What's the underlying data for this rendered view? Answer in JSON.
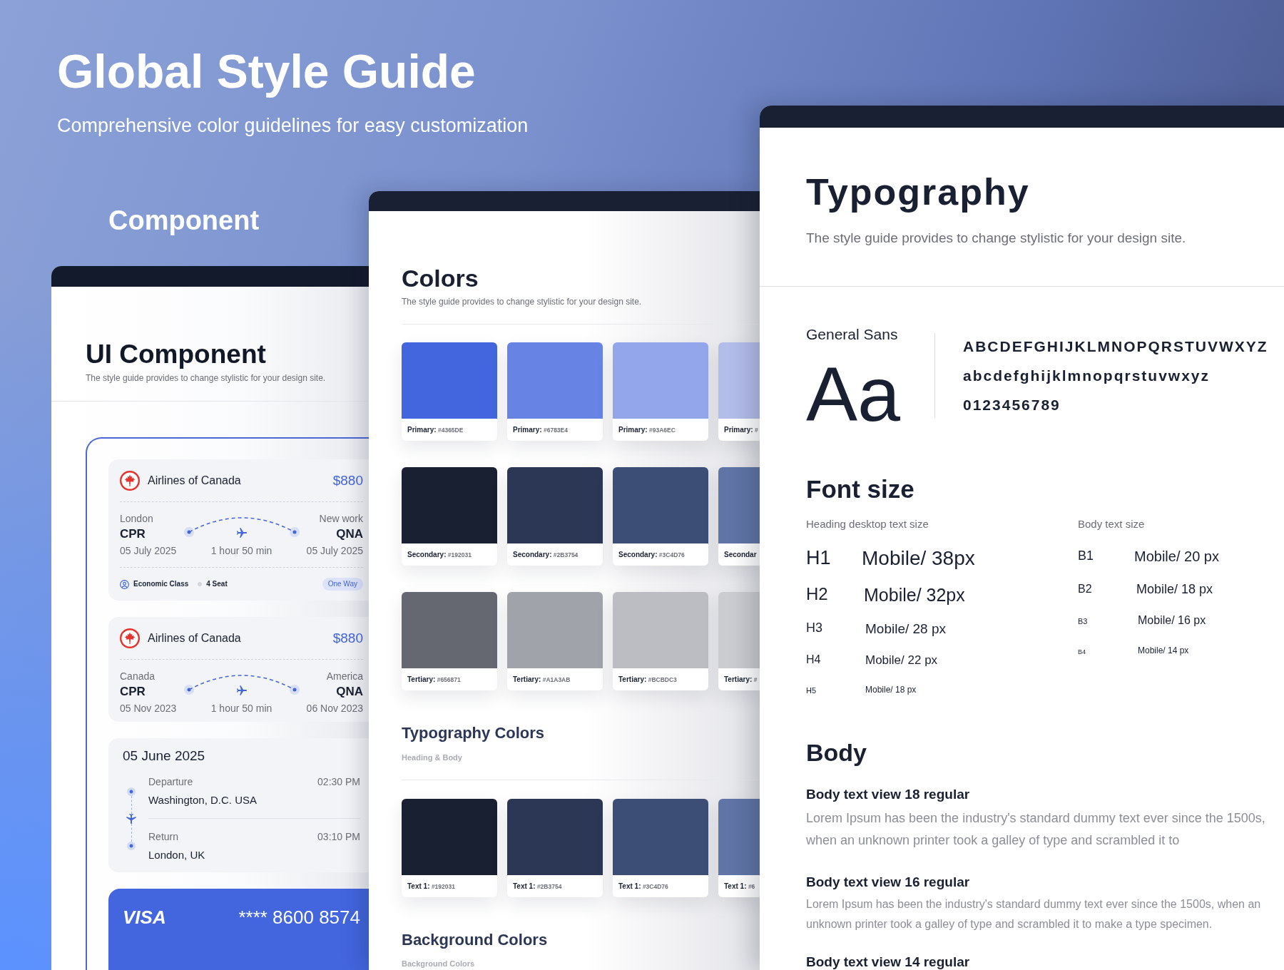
{
  "header": {
    "title": "Global Style Guide",
    "subtitle": "Comprehensive color guidelines for easy customization"
  },
  "component_section": {
    "label": "Component",
    "panel": {
      "title": "UI Component",
      "description": "The style guide provides to change stylistic for your design site.",
      "flights": [
        {
          "airline": "Airlines of Canada",
          "price": "$880",
          "origin": {
            "city": "London",
            "code": "CPR",
            "date": "05 July 2025"
          },
          "destination": {
            "city": "New work",
            "code": "QNA",
            "date": "05 July 2025"
          },
          "duration": "1 hour 50 min",
          "details": {
            "cabin": "Economic Class",
            "seats": "4 Seat",
            "trip_type": "One Way"
          }
        },
        {
          "airline": "Airlines of Canada",
          "price": "$880",
          "origin": {
            "city": "Canada",
            "code": "CPR",
            "date": "05 Nov 2023"
          },
          "destination": {
            "city": "America",
            "code": "QNA",
            "date": "06 Nov 2023"
          },
          "duration": "1 hour 50 min"
        }
      ],
      "itinerary": {
        "date": "05 June 2025",
        "legs": [
          {
            "label": "Departure",
            "time": "02:30 PM",
            "place": "Washington, D.C. USA"
          },
          {
            "label": "Return",
            "time": "03:10 PM",
            "place": "London, UK"
          }
        ]
      },
      "payment_card": {
        "brand": "VISA",
        "number": "**** 8600 8574"
      }
    }
  },
  "colors_panel": {
    "title": "Colors",
    "description": "The style guide provides to change stylistic for your design site.",
    "palettes": [
      {
        "swatches": [
          {
            "name": "Primary:",
            "code": "#4365DE",
            "color": "#4365de"
          },
          {
            "name": "Primary:",
            "code": "#6783E4",
            "color": "#6783e4"
          },
          {
            "name": "Primary:",
            "code": "#93A6EC",
            "color": "#93a6ec"
          },
          {
            "name": "Primary:",
            "code": "#",
            "color": "#b3bdea"
          }
        ]
      },
      {
        "swatches": [
          {
            "name": "Secondary:",
            "code": "#192031",
            "color": "#192031"
          },
          {
            "name": "Secondary:",
            "code": "#2B3754",
            "color": "#2b3754"
          },
          {
            "name": "Secondary:",
            "code": "#3C4D76",
            "color": "#3c4d76"
          },
          {
            "name": "Secondar",
            "color": "#6075a6"
          }
        ]
      },
      {
        "swatches": [
          {
            "name": "Tertiary:",
            "code": "#656871",
            "color": "#656871"
          },
          {
            "name": "Tertiary:",
            "code": "#A1A3AB",
            "color": "#a1a3ab"
          },
          {
            "name": "Tertiary:",
            "code": "#BCBDC3",
            "color": "#bcbdc3"
          },
          {
            "name": "Tertiary:",
            "code": "#",
            "color": "#cbccd0"
          }
        ]
      }
    ],
    "typography_colors": {
      "title": "Typography Colors",
      "subtitle": "Heading & Body",
      "swatches": [
        {
          "name": "Text 1:",
          "code": "#192031",
          "color": "#192031"
        },
        {
          "name": "Text 1:",
          "code": "#2B3754",
          "color": "#2b3754"
        },
        {
          "name": "Text 1:",
          "code": "#3C4D76",
          "color": "#3c4d76"
        },
        {
          "name": "Text 1:",
          "code": "#6",
          "color": "#6075a6"
        }
      ]
    },
    "background_colors": {
      "title": "Background Colors",
      "subtitle": "Background Colors"
    }
  },
  "typography_panel": {
    "title": "Typography",
    "description": "The style guide provides to change stylistic for your design site.",
    "typeface": {
      "family": "General Sans",
      "sample": "Aa",
      "glyph_rows": [
        "ABCDEFGHIJKLMNOPQRSTUVWXYZ",
        "abcdefghijklmnopqrstuvwxyz",
        "0123456789"
      ]
    },
    "font_size": {
      "title": "Font size",
      "heading_scale": {
        "label": "Heading desktop text size",
        "rows": [
          {
            "tag": "H1",
            "size": "Mobile/ 38px"
          },
          {
            "tag": "H2",
            "size": "Mobile/ 32px"
          },
          {
            "tag": "H3",
            "size": "Mobile/ 28 px"
          },
          {
            "tag": "H4",
            "size": "Mobile/ 22 px"
          },
          {
            "tag": "H5",
            "size": "Mobile/ 18 px"
          }
        ]
      },
      "body_scale": {
        "label": "Body text size",
        "rows": [
          {
            "tag": "B1",
            "size": "Mobile/ 20 px"
          },
          {
            "tag": "B2",
            "size": "Mobile/ 18 px"
          },
          {
            "tag": "B3",
            "size": "Mobile/ 16 px"
          },
          {
            "tag": "B4",
            "size": "Mobile/ 14 px"
          }
        ]
      }
    },
    "body": {
      "title": "Body",
      "samples": [
        {
          "title": "Body text view 18 regular",
          "text": "Lorem Ipsum has been the industry's standard dummy text ever since the 1500s, when an unknown printer took a galley of  type and scrambled it to"
        },
        {
          "title": "Body text view 16 regular",
          "text": "Lorem Ipsum has been the industry's standard dummy text ever since the 1500s, when an unknown printer took a galley of  type and scrambled it to make a type specimen."
        },
        {
          "title": "Body text view 14 regular"
        }
      ]
    }
  }
}
